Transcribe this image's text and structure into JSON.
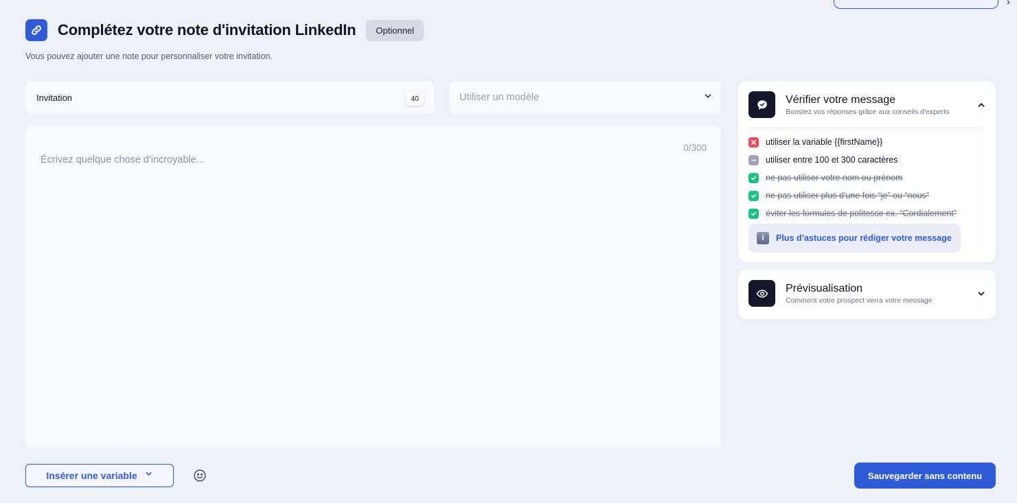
{
  "header": {
    "title": "Complétez votre note d'invitation LinkedIn",
    "badge": "Optionnel",
    "subtitle": "Vous pouvez ajouter une note pour personnaliser votre invitation."
  },
  "name_field": {
    "value": "Invitation",
    "counter": "40"
  },
  "template_select": {
    "placeholder": "Utiliser un modèle"
  },
  "editor": {
    "placeholder": "Écrivez quelque chose d'incroyable...",
    "char_count": "0/300"
  },
  "verify_card": {
    "title": "Vérifier votre message",
    "subtitle": "Boostez vos réponses grâce aux conseils d'experts",
    "checks": [
      {
        "label": "utiliser la variable {{firstName}}",
        "status": "fail"
      },
      {
        "label": "utiliser entre 100 et 300 caractères",
        "status": "neutral"
      },
      {
        "label": "ne pas utiliser votre nom ou prénom",
        "status": "pass"
      },
      {
        "label": "ne pas utiliser plus d'une fois “je” ou “nous”",
        "status": "pass"
      },
      {
        "label": "éviter les formules de politesse ex. “Cordialement”",
        "status": "pass"
      }
    ],
    "tips_button": "Plus d’astuces pour rédiger votre message"
  },
  "preview_card": {
    "title": "Prévisualisation",
    "subtitle": "Comment votre prospect verra votre message"
  },
  "footer": {
    "insert_variable": "Insérer une variable",
    "save": "Sauvegarder sans contenu"
  },
  "colors": {
    "accent": "#2f5bd9",
    "fail": "#ef4c5b",
    "pass": "#19c382",
    "neutral": "#9fa2b6"
  }
}
